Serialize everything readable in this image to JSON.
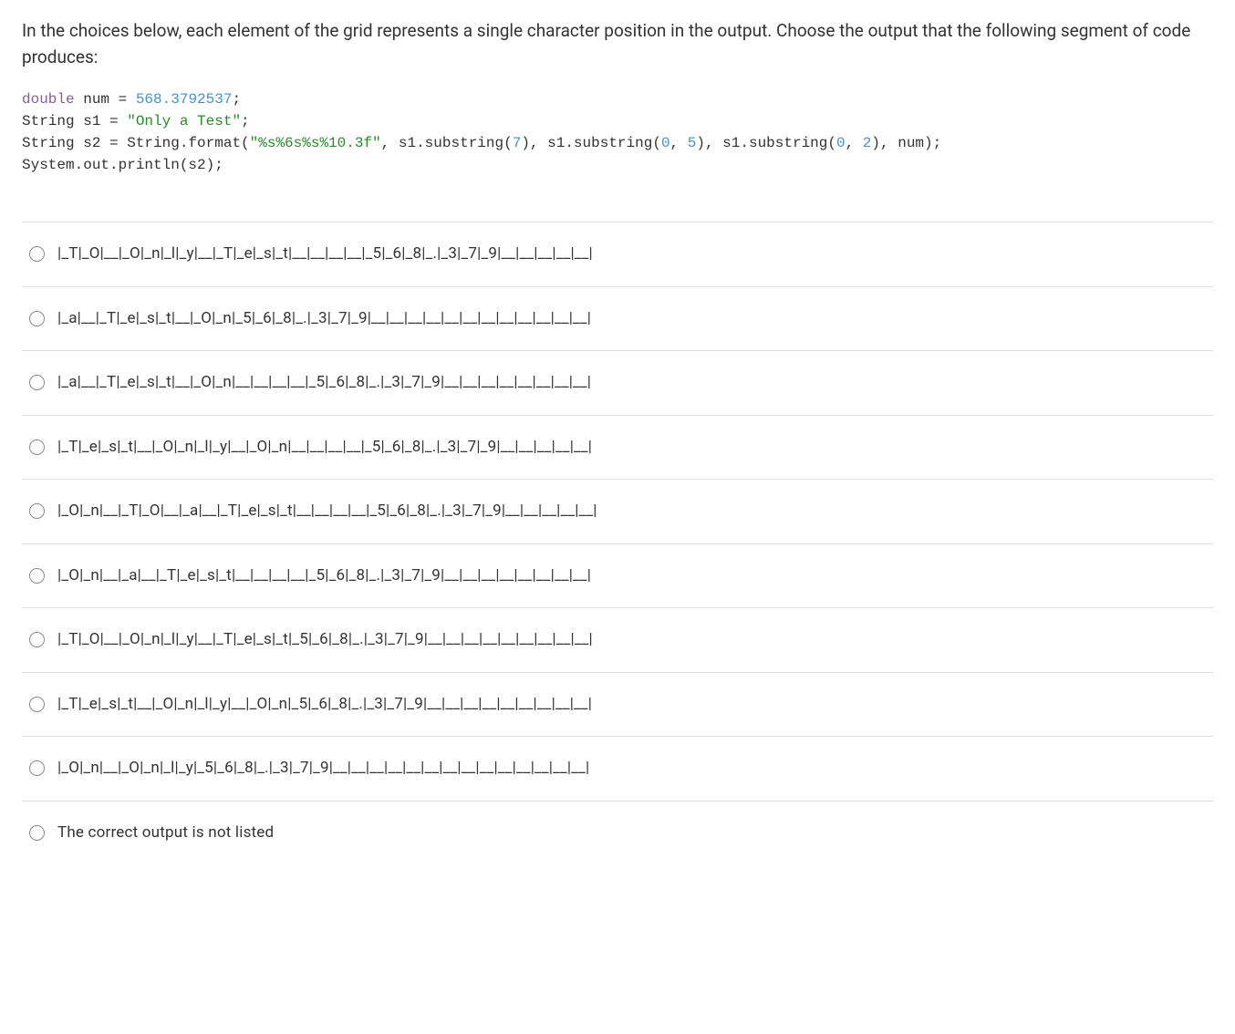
{
  "question": "In the choices below, each element of the grid represents a single character position in the output.  Choose the output that the following segment of code produces:",
  "code": {
    "kw_double": "double",
    "var_num": " num = ",
    "num_lit": "568.3792537",
    "semi1": ";",
    "line2a": "String s1 = ",
    "str1": "\"Only a Test\"",
    "semi2": ";",
    "line3a": "String s2 = String.format(",
    "str2": "\"%s%6s%s%10.3f\"",
    "line3b": ", s1.substring(",
    "n7": "7",
    "line3c": "), s1.substring(",
    "n0a": "0",
    "line3d": ", ",
    "n5": "5",
    "line3e": "), s1.substring(",
    "n0b": "0",
    "line3f": ", ",
    "n2": "2",
    "line3g": "), num);",
    "line4": "System.out.println(s2);"
  },
  "choices": [
    "|_T|_O|__|_O|_n|_l|_y|__|_T|_e|_s|_t|__|__|__|__|_5|_6|_8|_.|_3|_7|_9|__|__|__|__|__|",
    "|_a|__|_T|_e|_s|_t|__|_O|_n|_5|_6|_8|_.|_3|_7|_9|__|__|__|__|__|__|__|__|__|__|__|__|",
    "|_a|__|_T|_e|_s|_t|__|_O|_n|__|__|__|__|_5|_6|_8|_.|_3|_7|_9|__|__|__|__|__|__|__|__|",
    "|_T|_e|_s|_t|__|_O|_n|_l|_y|__|_O|_n|__|__|__|__|_5|_6|_8|_.|_3|_7|_9|__|__|__|__|__|",
    "|_O|_n|__|_T|_O|__|_a|__|_T|_e|_s|_t|__|__|__|__|_5|_6|_8|_.|_3|_7|_9|__|__|__|__|__|",
    "|_O|_n|__|_a|__|_T|_e|_s|_t|__|__|__|__|_5|_6|_8|_.|_3|_7|_9|__|__|__|__|__|__|__|__|",
    "|_T|_O|__|_O|_n|_l|_y|__|_T|_e|_s|_t|_5|_6|_8|_.|_3|_7|_9|__|__|__|__|__|__|__|__|__|",
    "|_T|_e|_s|_t|__|_O|_n|_l|_y|__|_O|_n|_5|_6|_8|_.|_3|_7|_9|__|__|__|__|__|__|__|__|__|",
    "|_O|_n|__|_O|_n|_l|_y|_5|_6|_8|_.|_3|_7|_9|__|__|__|__|__|__|__|__|__|__|__|__|__|__|",
    "The correct output is not listed"
  ]
}
